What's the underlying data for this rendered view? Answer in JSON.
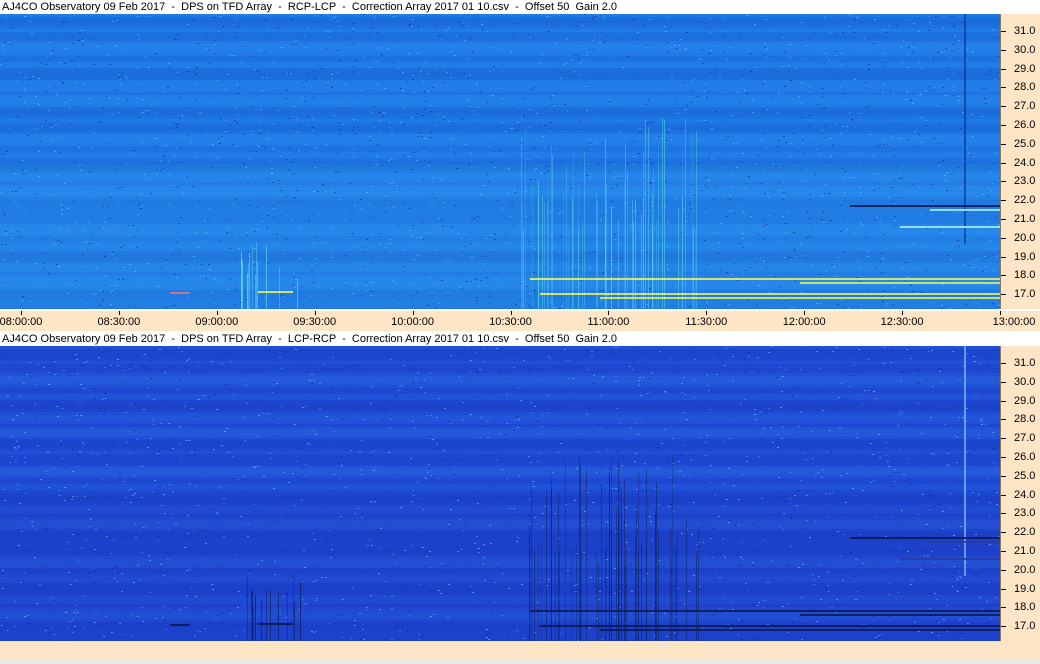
{
  "panels": [
    {
      "title": "AJ4CO Observatory 09 Feb 2017  -  DPS on TFD Array  -  RCP-LCP  -  Correction Array 2017 01 10.csv  -  Offset 50  Gain 2.0",
      "base_color": "#1e78e6",
      "freq_labels": [
        "31.0",
        "30.0",
        "29.0",
        "28.0",
        "27.0",
        "26.0",
        "25.0",
        "24.0",
        "23.0",
        "22.0",
        "21.0",
        "20.0",
        "19.0",
        "18.0",
        "17.0"
      ]
    },
    {
      "title": "AJ4CO Observatory 09 Feb 2017  -  DPS on TFD Array  -  LCP-RCP  -  Correction Array 2017 01 10.csv  -  Offset 50  Gain 2.0",
      "base_color": "#1f4ad6",
      "freq_labels": [
        "31.0",
        "30.0",
        "29.0",
        "28.0",
        "27.0",
        "26.0",
        "25.0",
        "24.0",
        "23.0",
        "22.0",
        "21.0",
        "20.0",
        "19.0",
        "18.0",
        "17.0"
      ]
    }
  ],
  "time_labels": [
    "08:00:00",
    "08:30:00",
    "09:00:00",
    "09:30:00",
    "10:00:00",
    "10:30:00",
    "11:00:00",
    "11:30:00",
    "12:00:00",
    "12:30:00",
    "13:00:00"
  ],
  "colors": {
    "axis_bg": "#fde5c6",
    "burst_yellow": "#f2f25a",
    "burst_cyan": "#5fe3e8",
    "dark_line": "#0a1a50"
  }
}
